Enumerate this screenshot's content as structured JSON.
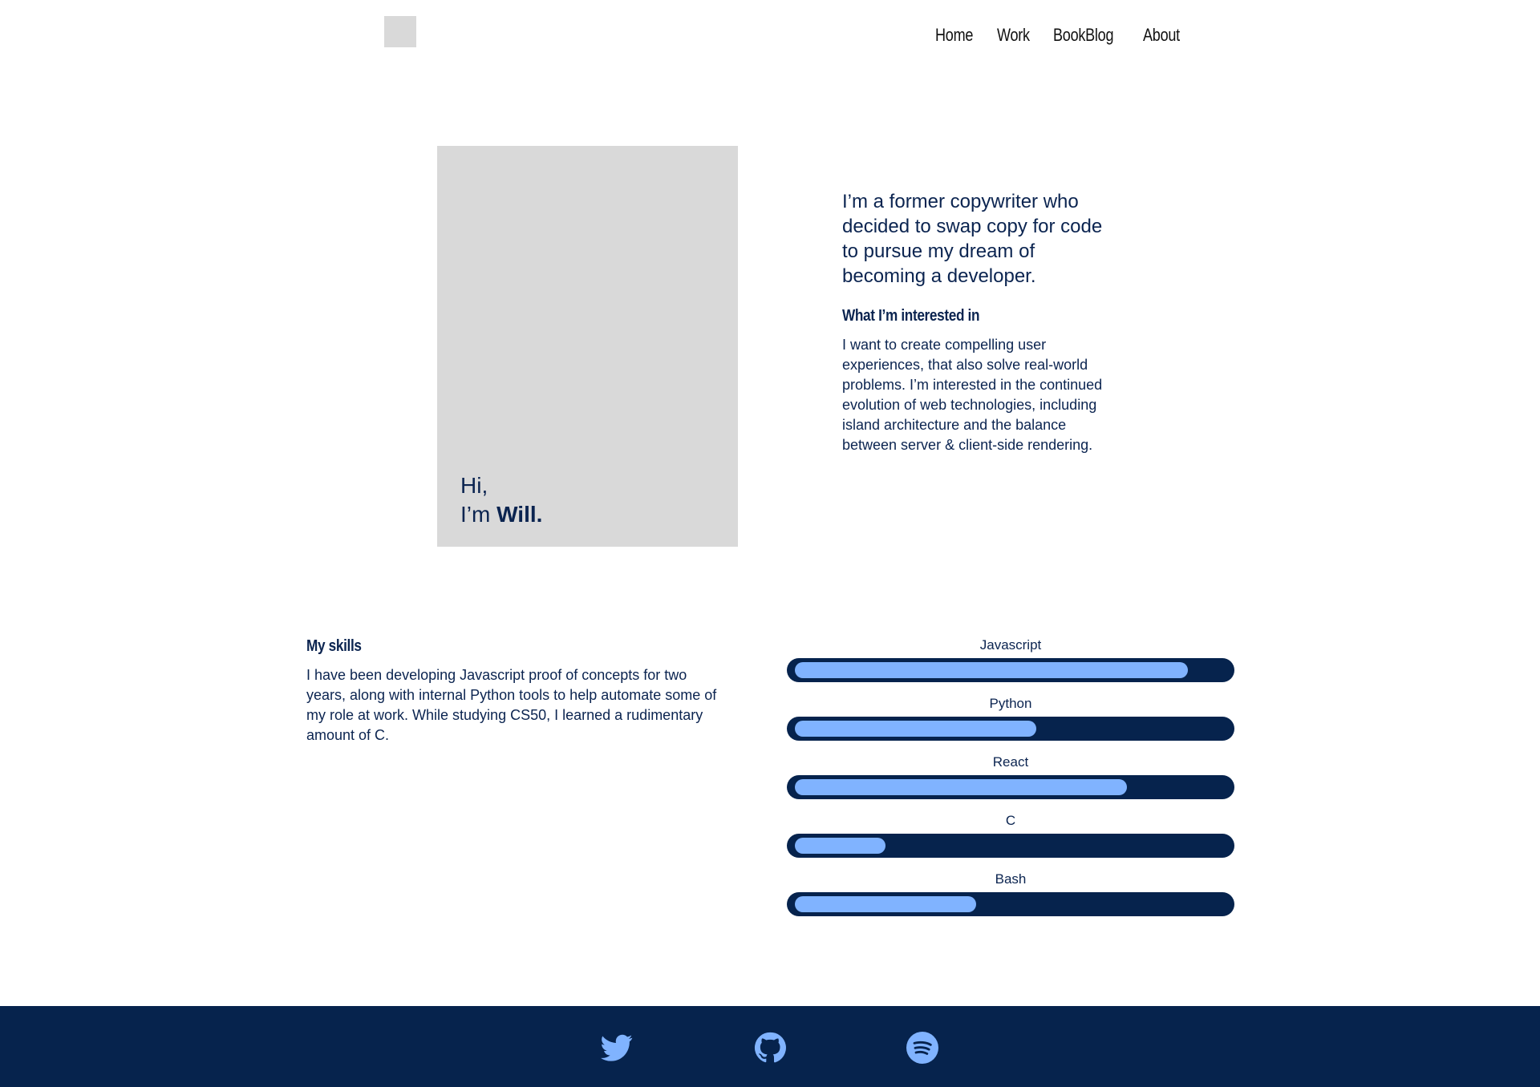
{
  "header": {
    "nav": [
      {
        "label": "Home"
      },
      {
        "label": "Work"
      },
      {
        "label": "BookBlog"
      },
      {
        "label": "About"
      }
    ]
  },
  "hero": {
    "greeting_line1": "Hi,",
    "greeting_prefix": "I’m ",
    "greeting_name": "Will.",
    "intro": "I’m a former copywriter who decided to swap copy for code to pursue my dream of becoming a developer.",
    "interest_heading": "What I’m interested in",
    "interest_text": "I want to create compelling user experiences, that also solve real-world problems. I’m interested in the continued evolution of web technologies, including island architecture and the balance between server & client-side rendering."
  },
  "skills": {
    "heading": "My skills",
    "text": "I have been developing Javascript proof of concepts for two years, along with internal Python tools to help automate some of my role at work. While studying CS50, I learned a rudimentary amount of C.",
    "items": [
      {
        "name": "Javascript",
        "level": 0.91
      },
      {
        "name": "Python",
        "level": 0.56
      },
      {
        "name": "React",
        "level": 0.77
      },
      {
        "name": "C",
        "level": 0.21
      },
      {
        "name": "Bash",
        "level": 0.42
      }
    ]
  },
  "footer": {
    "icons": [
      "twitter-icon",
      "github-icon",
      "spotify-icon"
    ],
    "icon_color": "#80b3ff",
    "background": "#06234d"
  },
  "colors": {
    "text": "#0b2450",
    "bar_track": "#06234d",
    "bar_fill": "#80b3ff",
    "placeholder": "#d9d9d9"
  }
}
